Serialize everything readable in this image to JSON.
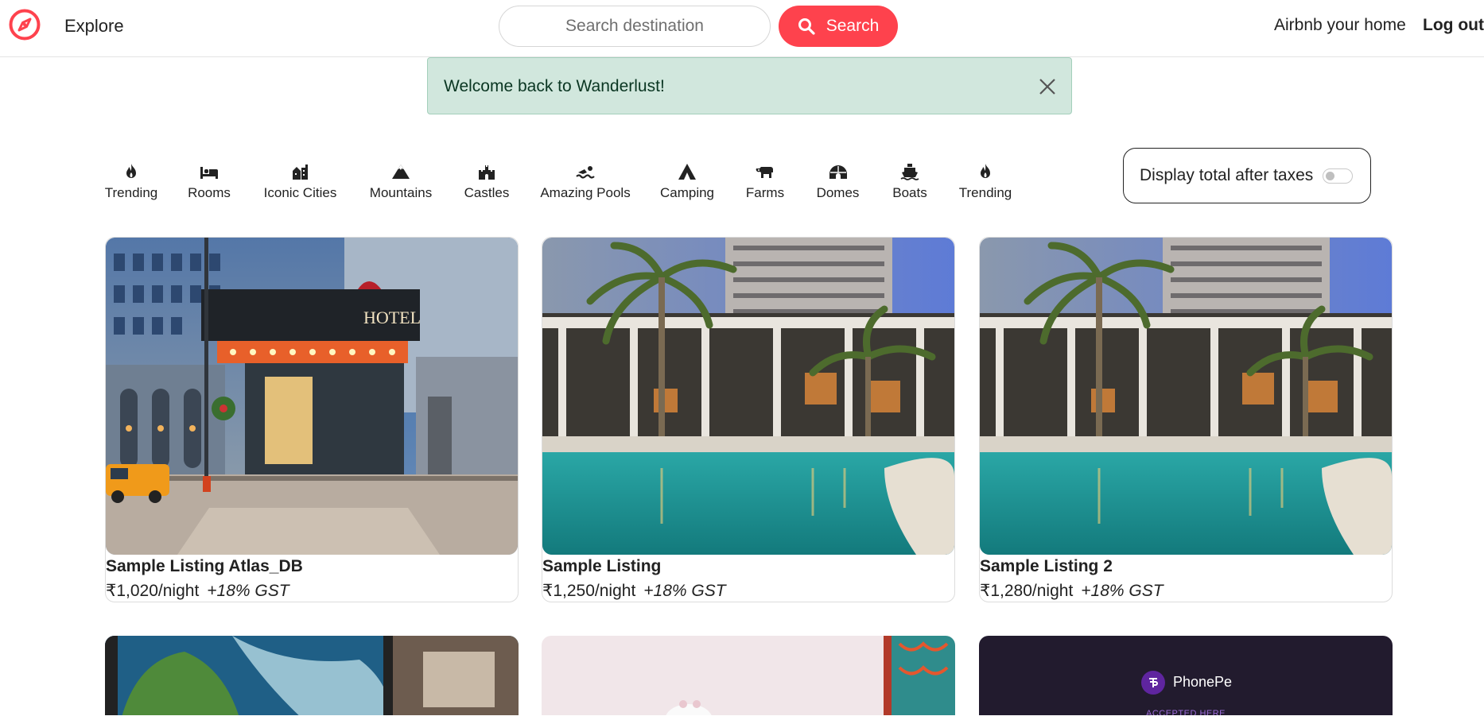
{
  "navbar": {
    "explore": "Explore",
    "search_placeholder": "Search destination",
    "search_button": "Search",
    "host_link": "Airbnb your home",
    "logout": "Log out",
    "brand_color": "#fe424d"
  },
  "flash": {
    "message": "Welcome back to Wanderlust!"
  },
  "filters": [
    {
      "label": "Trending",
      "icon": "fire-icon"
    },
    {
      "label": "Rooms",
      "icon": "bed-icon"
    },
    {
      "label": "Iconic Cities",
      "icon": "city-icon"
    },
    {
      "label": "Mountains",
      "icon": "mountain-icon"
    },
    {
      "label": "Castles",
      "icon": "castle-icon"
    },
    {
      "label": "Amazing Pools",
      "icon": "swimmer-icon"
    },
    {
      "label": "Camping",
      "icon": "tent-icon"
    },
    {
      "label": "Farms",
      "icon": "cow-icon"
    },
    {
      "label": "Domes",
      "icon": "igloo-icon"
    },
    {
      "label": "Boats",
      "icon": "ship-icon"
    },
    {
      "label": "Trending",
      "icon": "fire-icon"
    }
  ],
  "tax_toggle": {
    "label": "Display total after taxes",
    "enabled": false
  },
  "listings": [
    {
      "title": "Sample Listing Atlas_DB",
      "price": "₹1,020/night",
      "tax": "+18% GST",
      "image": "hotel-entrance"
    },
    {
      "title": "Sample Listing",
      "price": "₹1,250/night",
      "tax": "+18% GST",
      "image": "resort-pool"
    },
    {
      "title": "Sample Listing 2",
      "price": "₹1,280/night",
      "tax": "+18% GST",
      "image": "resort-pool"
    }
  ],
  "listings_row2": [
    {
      "image": "coastal-cliff"
    },
    {
      "image": "pink-room"
    },
    {
      "image": "phonepe-sign",
      "brand": "PhonePe",
      "caption": "ACCEPTED HERE"
    }
  ]
}
